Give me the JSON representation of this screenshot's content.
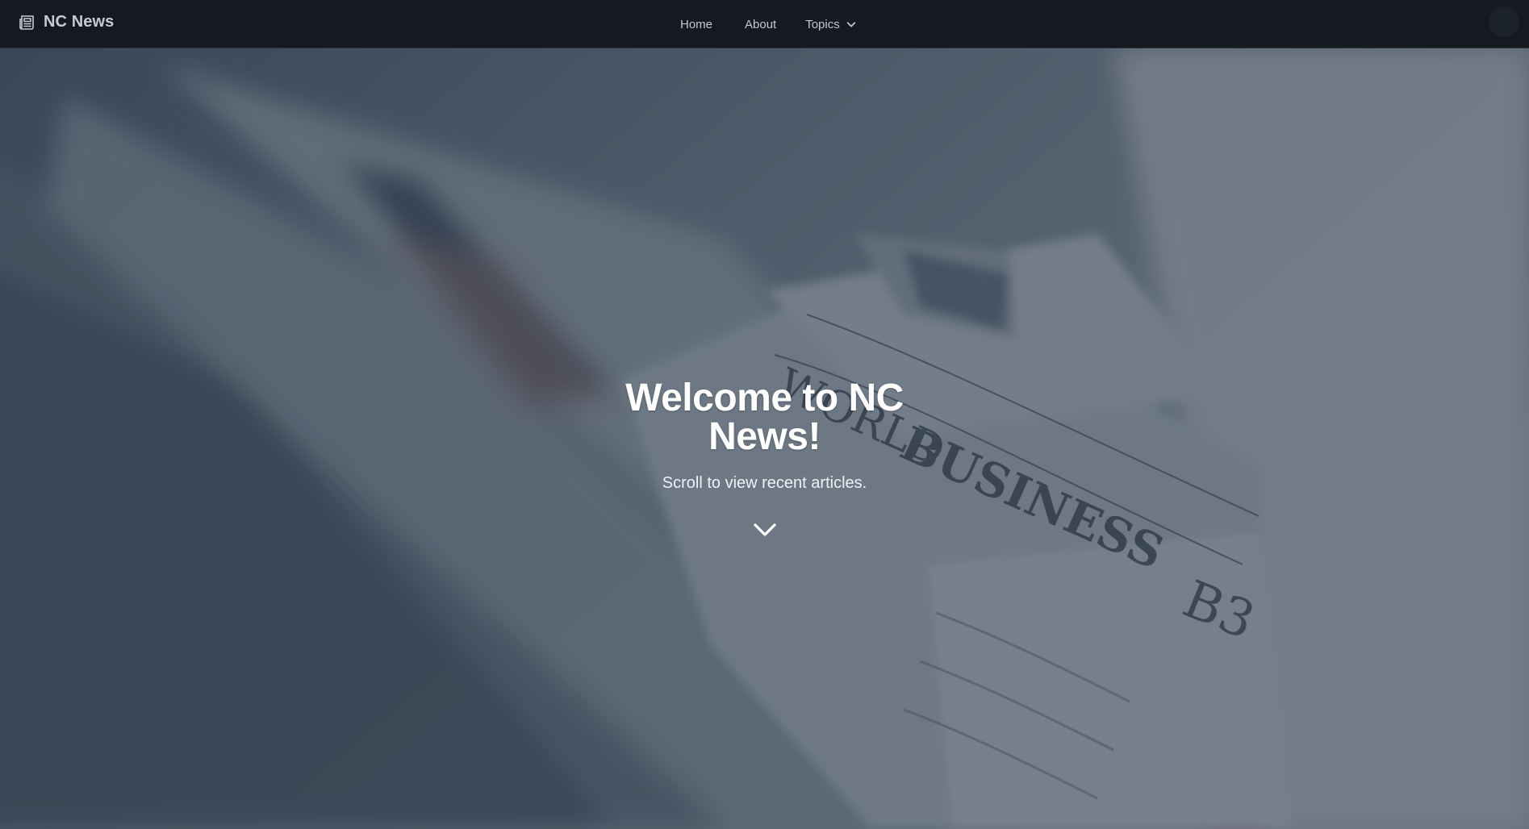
{
  "header": {
    "brand": "NC News",
    "nav": {
      "home": "Home",
      "about": "About",
      "topics": "Topics"
    }
  },
  "hero": {
    "title": "Welcome to NC News!",
    "subtitle": "Scroll to view recent articles.",
    "background_image": {
      "newspaper_headline_1": "WORLD",
      "newspaper_headline_2": "BUSINESS",
      "newspaper_page": "B3"
    }
  },
  "icons": {
    "brand": "newspaper-icon",
    "topics_dropdown": "chevron-down-icon",
    "scroll": "chevron-down-icon",
    "user": "avatar"
  },
  "colors": {
    "navbar_bg": "#151a20",
    "nav_text": "#c3c8cf",
    "hero_text": "#ffffff"
  }
}
